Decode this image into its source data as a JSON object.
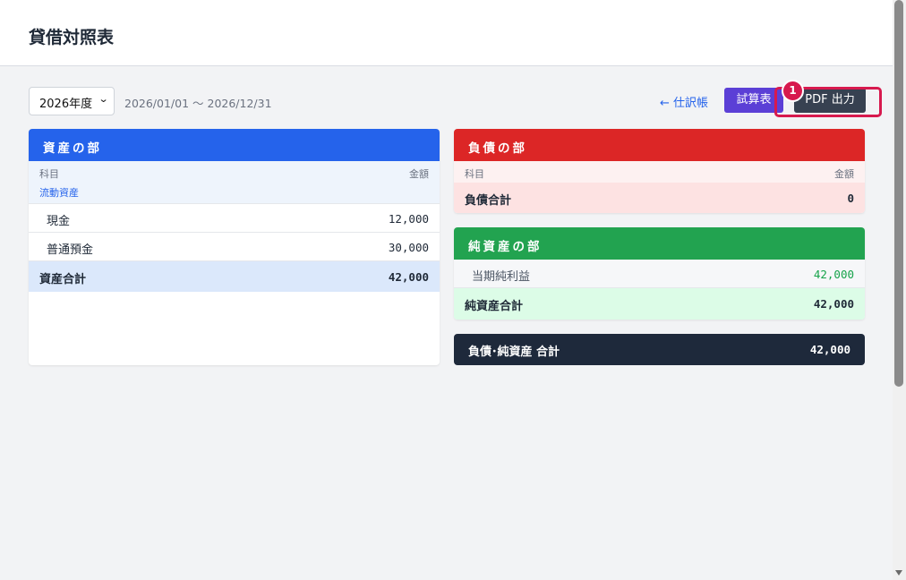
{
  "header": {
    "title": "貸借対照表"
  },
  "toolbar": {
    "year_select": {
      "value": "2026年度"
    },
    "period": "2026/01/01 〜 2026/12/31",
    "journal_link": "← 仕訳帳",
    "trial_balance_button": "試算表",
    "pdf_button": "PDF 出力",
    "annotation_badge": "1"
  },
  "assets": {
    "title": "資産の部",
    "col_subject": "科目",
    "col_amount": "金額",
    "category": "流動資産",
    "items": [
      {
        "name": "現金",
        "amount": "12,000"
      },
      {
        "name": "普通預金",
        "amount": "30,000"
      }
    ],
    "total_label": "資産合計",
    "total_amount": "42,000"
  },
  "liabilities": {
    "title": "負債の部",
    "col_subject": "科目",
    "col_amount": "金額",
    "total_label": "負債合計",
    "total_amount": "0"
  },
  "net_assets": {
    "title": "純資産の部",
    "items": [
      {
        "name": "当期純利益",
        "amount": "42,000"
      }
    ],
    "total_label": "純資産合計",
    "total_amount": "42,000"
  },
  "grand_total": {
    "label": "負債･純資産 合計",
    "amount": "42,000"
  },
  "colors": {
    "assets_header": "#2563eb",
    "liabilities_header": "#dc2626",
    "net_assets_header": "#22a350",
    "grand_total_bg": "#1e293b",
    "trial_button": "#5b3fd6",
    "pdf_button": "#374151",
    "annotation": "#d7194e"
  }
}
